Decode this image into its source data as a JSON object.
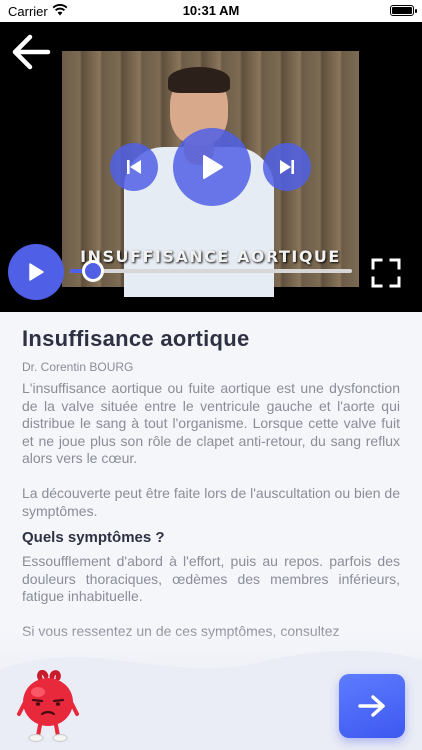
{
  "status_bar": {
    "carrier": "Carrier",
    "time": "10:31 AM"
  },
  "video": {
    "caption": "Insuffisance aortique",
    "progress_fraction": 0.08
  },
  "article": {
    "title": "Insuffisance aortique",
    "author": "Dr. Corentin BOURG",
    "paragraphs": [
      "L'insuffisance aortique ou fuite aortique est une dysfonction de la valve située entre le ventricule gauche et l'aorte qui distribue le sang à tout l'organisme. Lorsque cette valve fuit et ne joue plus son rôle de clapet anti-retour, du sang reflux alors vers le cœur.",
      "La découverte peut être faite lors de l'auscultation ou bien de symptômes."
    ],
    "subtitle": "Quels symptômes ?",
    "symptoms": "Essoufflement d'abord à l'effort, puis au repos. parfois des douleurs thoraciques, œdèmes des membres inférieurs, fatigue inhabituelle.",
    "cut_paragraph": "Si vous ressentez un de ces symptômes, consultez"
  },
  "colors": {
    "accent": "#4f5fe6",
    "title": "#2d3142",
    "body_text": "#8a8d99"
  },
  "icons": {
    "back": "arrow-left-icon",
    "previous": "skip-previous-icon",
    "play": "play-icon",
    "next": "skip-next-icon",
    "fullscreen": "fullscreen-icon",
    "continue": "arrow-right-icon",
    "mascot": "heart-mascot-icon"
  }
}
